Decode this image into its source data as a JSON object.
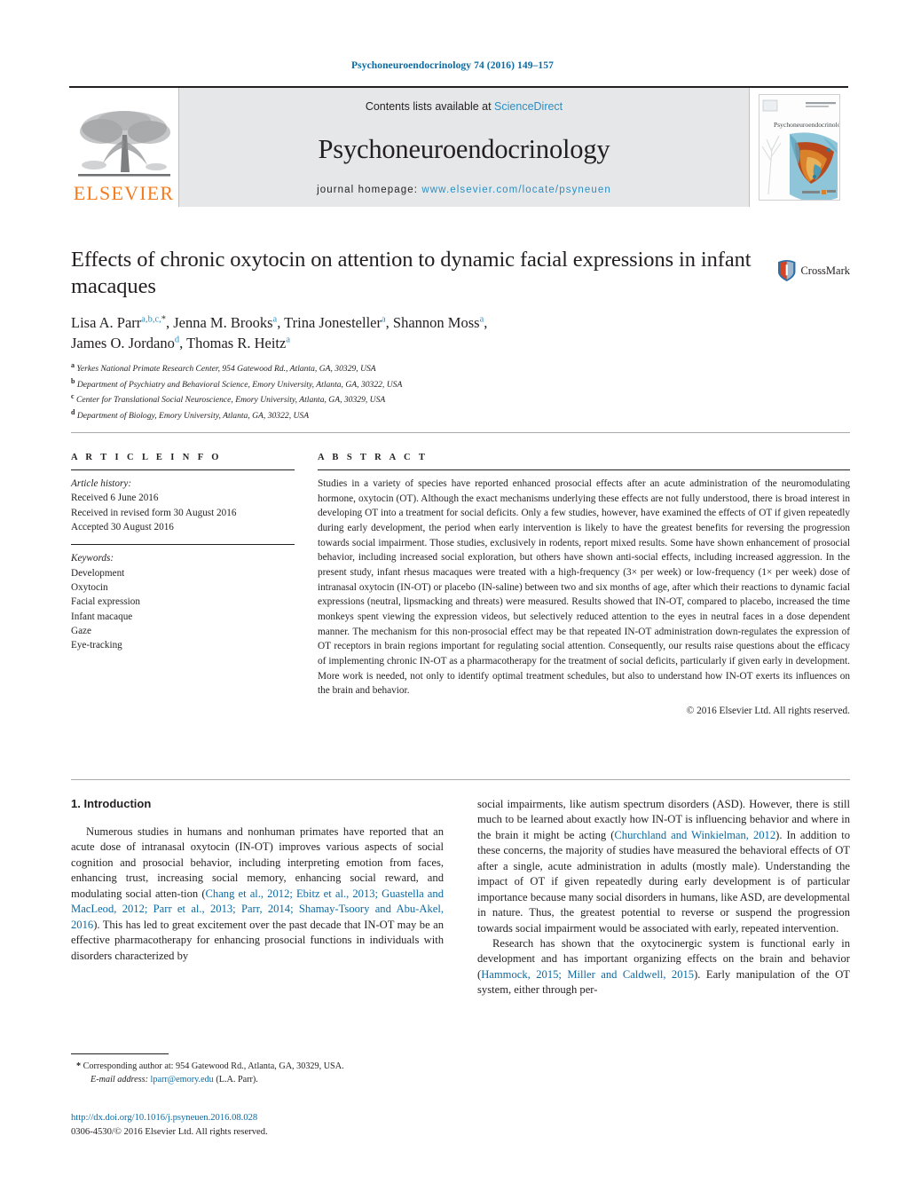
{
  "running_head": "Psychoneuroendocrinology 74 (2016) 149–157",
  "masthead": {
    "publisher_name": "ELSEVIER",
    "contents_prefix": "Contents lists available at ",
    "contents_link": "ScienceDirect",
    "journal_title": "Psychoneuroendocrinology",
    "homepage_prefix": "journal homepage: ",
    "homepage_url": "www.elsevier.com/locate/psyneuen",
    "cover_journal_name": "Psychoneuroendocrinology",
    "accent_orange": "#f47c20",
    "accent_blue": "#2b8fc4"
  },
  "article": {
    "title": "Effects of chronic oxytocin on attention to dynamic facial expressions in infant macaques",
    "crossmark_label": "CrossMark",
    "authors_line_1_parts": [
      {
        "name": "Lisa A. Parr",
        "marks": "a,b,c,",
        "star": true
      },
      {
        "name": "Jenna M. Brooks",
        "marks": "a"
      },
      {
        "name": "Trina Jonesteller",
        "marks": "a"
      },
      {
        "name": "Shannon Moss",
        "marks": "a"
      }
    ],
    "authors_line_2_parts": [
      {
        "name": "James O. Jordano",
        "marks": "d"
      },
      {
        "name": "Thomas R. Heitz",
        "marks": "a"
      }
    ],
    "affiliations": [
      {
        "label": "a",
        "text": "Yerkes National Primate Research Center, 954 Gatewood Rd., Atlanta, GA, 30329, USA"
      },
      {
        "label": "b",
        "text": "Department of Psychiatry and Behavioral Science, Emory University, Atlanta, GA, 30322, USA"
      },
      {
        "label": "c",
        "text": "Center for Translational Social Neuroscience, Emory University, Atlanta, GA, 30329, USA"
      },
      {
        "label": "d",
        "text": "Department of Biology, Emory University, Atlanta, GA, 30322, USA"
      }
    ]
  },
  "article_info": {
    "heading": "A R T I C L E   I N F O",
    "history_title": "Article history:",
    "history": [
      "Received 6 June 2016",
      "Received in revised form 30 August 2016",
      "Accepted 30 August 2016"
    ],
    "keywords_title": "Keywords:",
    "keywords": [
      "Development",
      "Oxytocin",
      "Facial expression",
      "Infant macaque",
      "Gaze",
      "Eye-tracking"
    ]
  },
  "abstract": {
    "heading": "A B S T R A C T",
    "text": "Studies in a variety of species have reported enhanced prosocial effects after an acute administration of the neuromodulating hormone, oxytocin (OT). Although the exact mechanisms underlying these effects are not fully understood, there is broad interest in developing OT into a treatment for social deficits. Only a few studies, however, have examined the effects of OT if given repeatedly during early development, the period when early intervention is likely to have the greatest benefits for reversing the progression towards social impairment. Those studies, exclusively in rodents, report mixed results. Some have shown enhancement of prosocial behavior, including increased social exploration, but others have shown anti-social effects, including increased aggression. In the present study, infant rhesus macaques were treated with a high-frequency (3× per week) or low-frequency (1× per week) dose of intranasal oxytocin (IN-OT) or placebo (IN-saline) between two and six months of age, after which their reactions to dynamic facial expressions (neutral, lipsmacking and threats) were measured. Results showed that IN-OT, compared to placebo, increased the time monkeys spent viewing the expression videos, but selectively reduced attention to the eyes in neutral faces in a dose dependent manner. The mechanism for this non-prosocial effect may be that repeated IN-OT administration down-regulates the expression of OT receptors in brain regions important for regulating social attention. Consequently, our results raise questions about the efficacy of implementing chronic IN-OT as a pharmacotherapy for the treatment of social deficits, particularly if given early in development. More work is needed, not only to identify optimal treatment schedules, but also to understand how IN-OT exerts its influences on the brain and behavior.",
    "copyright": "© 2016 Elsevier Ltd. All rights reserved."
  },
  "introduction": {
    "heading": "1. Introduction",
    "left_paragraph_pre": "Numerous studies in humans and nonhuman primates have reported that an acute dose of intranasal oxytocin (IN-OT) improves various aspects of social cognition and prosocial behavior, including interpreting emotion from faces, enhancing trust, increasing social memory, enhancing social reward, and modulating social atten-tion (",
    "left_paragraph_cite": "Chang et al., 2012; Ebitz et al., 2013; Guastella and MacLeod, 2012; Parr et al., 2013; Parr, 2014; Shamay-Tsoory and Abu-Akel, 2016",
    "left_paragraph_post": "). This has led to great excitement over the past decade that IN-OT may be an effective pharmacotherapy for enhancing prosocial functions in individuals with disorders characterized by",
    "right_paragraph_1_pre": "social impairments, like autism spectrum disorders (ASD). However, there is still much to be learned about exactly how IN-OT is influencing behavior and where in the brain it might be acting (",
    "right_paragraph_1_cite": "Churchland and Winkielman, 2012",
    "right_paragraph_1_post": "). In addition to these concerns, the majority of studies have measured the behavioral effects of OT after a single, acute administration in adults (mostly male). Understanding the impact of OT if given repeatedly during early development is of particular importance because many social disorders in humans, like ASD, are developmental in nature. Thus, the greatest potential to reverse or suspend the progression towards social impairment would be associated with early, repeated intervention.",
    "right_paragraph_2_pre": "Research has shown that the oxytocinergic system is functional early in development and has important organizing effects on the brain and behavior (",
    "right_paragraph_2_cite": "Hammock, 2015; Miller and Caldwell, 2015",
    "right_paragraph_2_post": "). Early manipulation of the OT system, either through per-"
  },
  "footnote": {
    "star": "*",
    "corresponding": "Corresponding author at: 954 Gatewood Rd., Atlanta, GA, 30329, USA.",
    "email_label": "E-mail address:",
    "email": "lparr@emory.edu",
    "email_suffix": "(L.A. Parr)."
  },
  "doi_block": {
    "doi_url": "http://dx.doi.org/10.1016/j.psyneuen.2016.08.028",
    "issn_line": "0306-4530/© 2016 Elsevier Ltd. All rights reserved."
  }
}
